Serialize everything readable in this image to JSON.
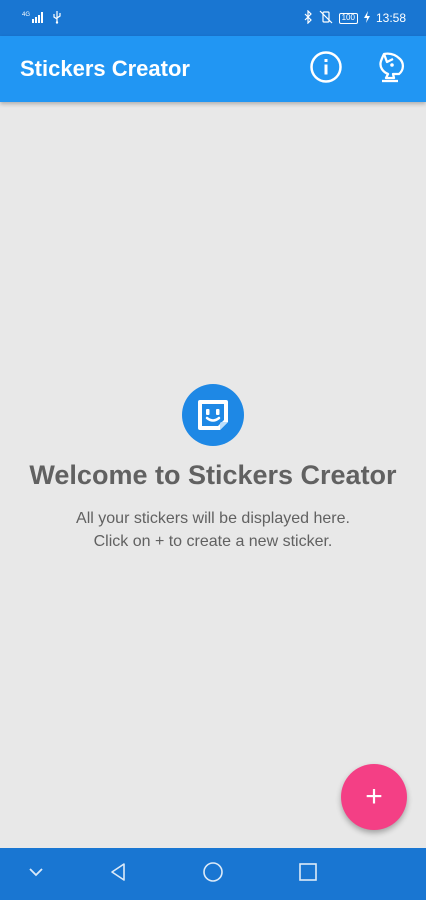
{
  "status_bar": {
    "signal_label": "4G",
    "battery": "100",
    "time": "13:58"
  },
  "app_bar": {
    "title": "Stickers Creator",
    "info_icon": "info-icon",
    "whatsapp_icon": "sticker-bird-icon"
  },
  "empty_state": {
    "title": "Welcome to Stickers Creator",
    "line1": "All your stickers will be displayed here.",
    "line2": "Click on + to create a new sticker."
  },
  "fab": {
    "label": "+"
  },
  "colors": {
    "status_bar": "#1976d2",
    "app_bar": "#2196f3",
    "background": "#e8e8e8",
    "fab": "#f43f85",
    "text_secondary": "#616161"
  }
}
